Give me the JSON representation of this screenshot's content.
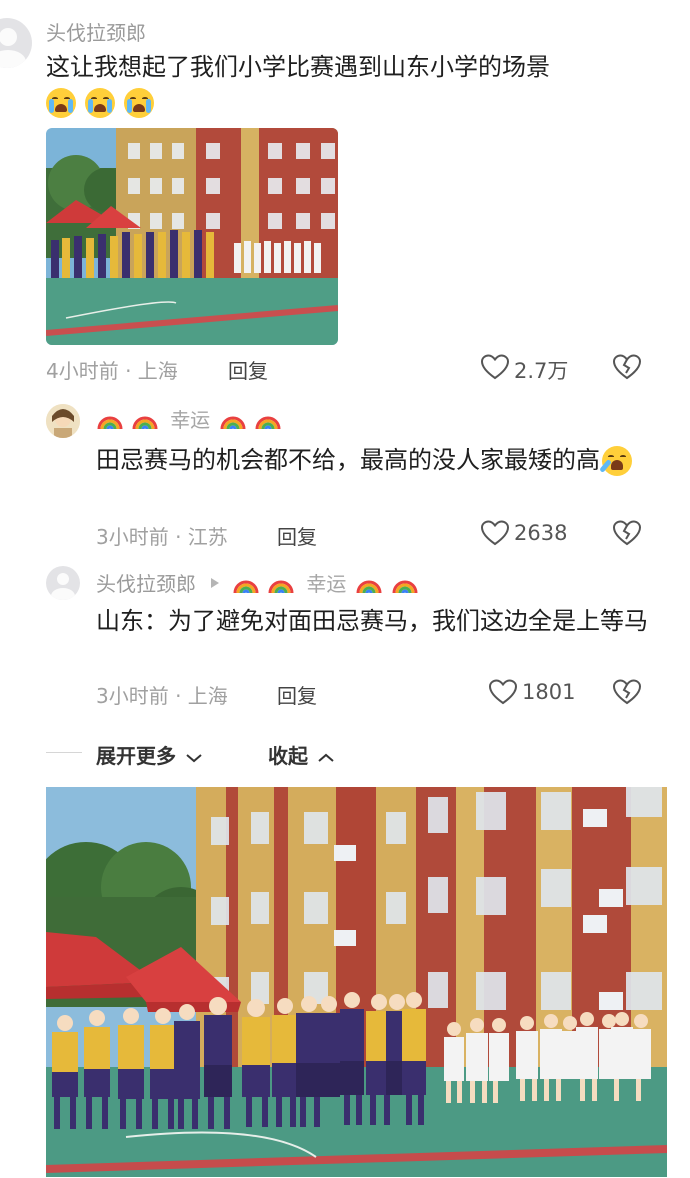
{
  "comments": [
    {
      "username": "头伐拉颈郎",
      "text": "这让我想起了我们小学比赛遇到山东小学的场景",
      "emoji": "crying-emoji",
      "meta": "4小时前 · 上海",
      "reply_label": "回复",
      "likes": "2.7万"
    },
    {
      "username_prefix_decor": "rainbow-icons",
      "username": "幸运",
      "text": "田忌赛马的机会都不给，最高的没人家最矮的高",
      "emoji": "laughing-emoji",
      "meta": "3小时前 · 江苏",
      "reply_label": "回复",
      "likes": "2638"
    },
    {
      "username": "头伐拉颈郎",
      "reply_to": "幸运",
      "text": "山东：为了避免对面田忌赛马，我们这边全是上等马",
      "meta": "3小时前 · 上海",
      "reply_label": "回复",
      "likes": "1801"
    }
  ],
  "expand": {
    "more_label": "展开更多",
    "collapse_label": "收起"
  },
  "colors": {
    "sky": "#7cb4d8",
    "building_red": "#b54b3a",
    "building_yellow": "#d9b05a",
    "court": "#4f9e86",
    "tent": "#cf3a3a",
    "jersey_purple": "#3a2f6e",
    "jersey_gold": "#e6b93a",
    "jersey_white": "#f2f2f2"
  }
}
